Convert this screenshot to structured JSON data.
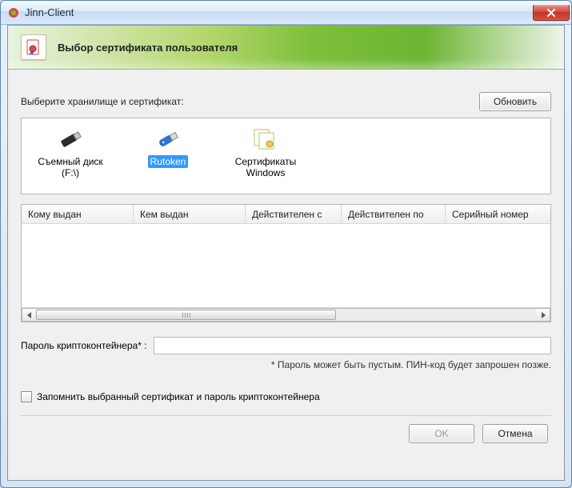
{
  "window": {
    "title": "Jinn-Client"
  },
  "banner": {
    "title": "Выбор сертификата пользователя"
  },
  "instruction": "Выберите хранилище и сертификат:",
  "buttons": {
    "refresh": "Обновить",
    "ok": "OK",
    "cancel": "Отмена"
  },
  "storages": [
    {
      "label": "Съемный диск (F:\\)",
      "icon": "usb-drive-icon",
      "selected": false
    },
    {
      "label": "Rutoken",
      "icon": "rutoken-icon",
      "selected": true
    },
    {
      "label": "Сертификаты Windows",
      "icon": "certificates-icon",
      "selected": false
    }
  ],
  "table": {
    "columns": [
      "Кому выдан",
      "Кем выдан",
      "Действителен с",
      "Действителен по",
      "Серийный номер"
    ],
    "rows": []
  },
  "password": {
    "label": "Пароль криптоконтейнера* :",
    "value": "",
    "hint": "* Пароль может быть пустым. ПИН-код будет запрошен позже."
  },
  "remember": {
    "checked": false,
    "label": "Запомнить выбранный сертификат и пароль криптоконтейнера"
  }
}
